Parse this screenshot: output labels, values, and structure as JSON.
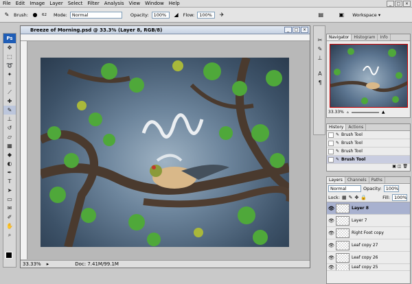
{
  "menu": [
    "File",
    "Edit",
    "Image",
    "Layer",
    "Select",
    "Filter",
    "Analysis",
    "View",
    "Window",
    "Help"
  ],
  "window_controls": [
    "_",
    "□",
    "×"
  ],
  "options": {
    "brush_label": "Brush:",
    "brush_size": "62",
    "mode_label": "Mode:",
    "mode_value": "Normal",
    "opacity_label": "Opacity:",
    "opacity_value": "100%",
    "flow_label": "Flow:",
    "flow_value": "100%",
    "workspace_label": "Workspace ▾"
  },
  "toolbox": {
    "logo": "Ps",
    "tools": [
      "move-tool",
      "marquee-tool",
      "lasso-tool",
      "magic-wand-tool",
      "crop-tool",
      "slice-tool",
      "healing-tool",
      "brush-tool",
      "stamp-tool",
      "history-brush-tool",
      "eraser-tool",
      "gradient-tool",
      "blur-tool",
      "dodge-tool",
      "pen-tool",
      "type-tool",
      "path-select-tool",
      "shape-tool",
      "notes-tool",
      "eyedropper-tool",
      "hand-tool",
      "zoom-tool"
    ]
  },
  "document": {
    "title": "Breeze of Morning.psd @ 33.3% (Layer 8, RGB/8)",
    "zoom": "33.33%",
    "doc_size": "Doc: 7.41M/99.1M"
  },
  "navigator": {
    "tabs": [
      "Navigator",
      "Histogram",
      "Info"
    ],
    "zoom": "33.33%"
  },
  "history": {
    "tabs": [
      "History",
      "Actions"
    ],
    "items": [
      {
        "label": "Brush Tool"
      },
      {
        "label": "Brush Tool"
      },
      {
        "label": "Brush Tool"
      },
      {
        "label": "Brush Tool"
      }
    ]
  },
  "layers": {
    "tabs": [
      "Layers",
      "Channels",
      "Paths"
    ],
    "blend_mode": "Normal",
    "opacity_label": "Opacity:",
    "opacity_value": "100%",
    "lock_label": "Lock:",
    "fill_label": "Fill:",
    "fill_value": "100%",
    "items": [
      {
        "name": "Layer 8"
      },
      {
        "name": "Layer 7"
      },
      {
        "name": "Right Foot copy"
      },
      {
        "name": "Leaf copy 27"
      },
      {
        "name": "Leaf copy 26"
      },
      {
        "name": "Leaf copy 25"
      }
    ]
  },
  "colors": {
    "accent": "#1f5db6",
    "selection": "#a8b1cf"
  }
}
